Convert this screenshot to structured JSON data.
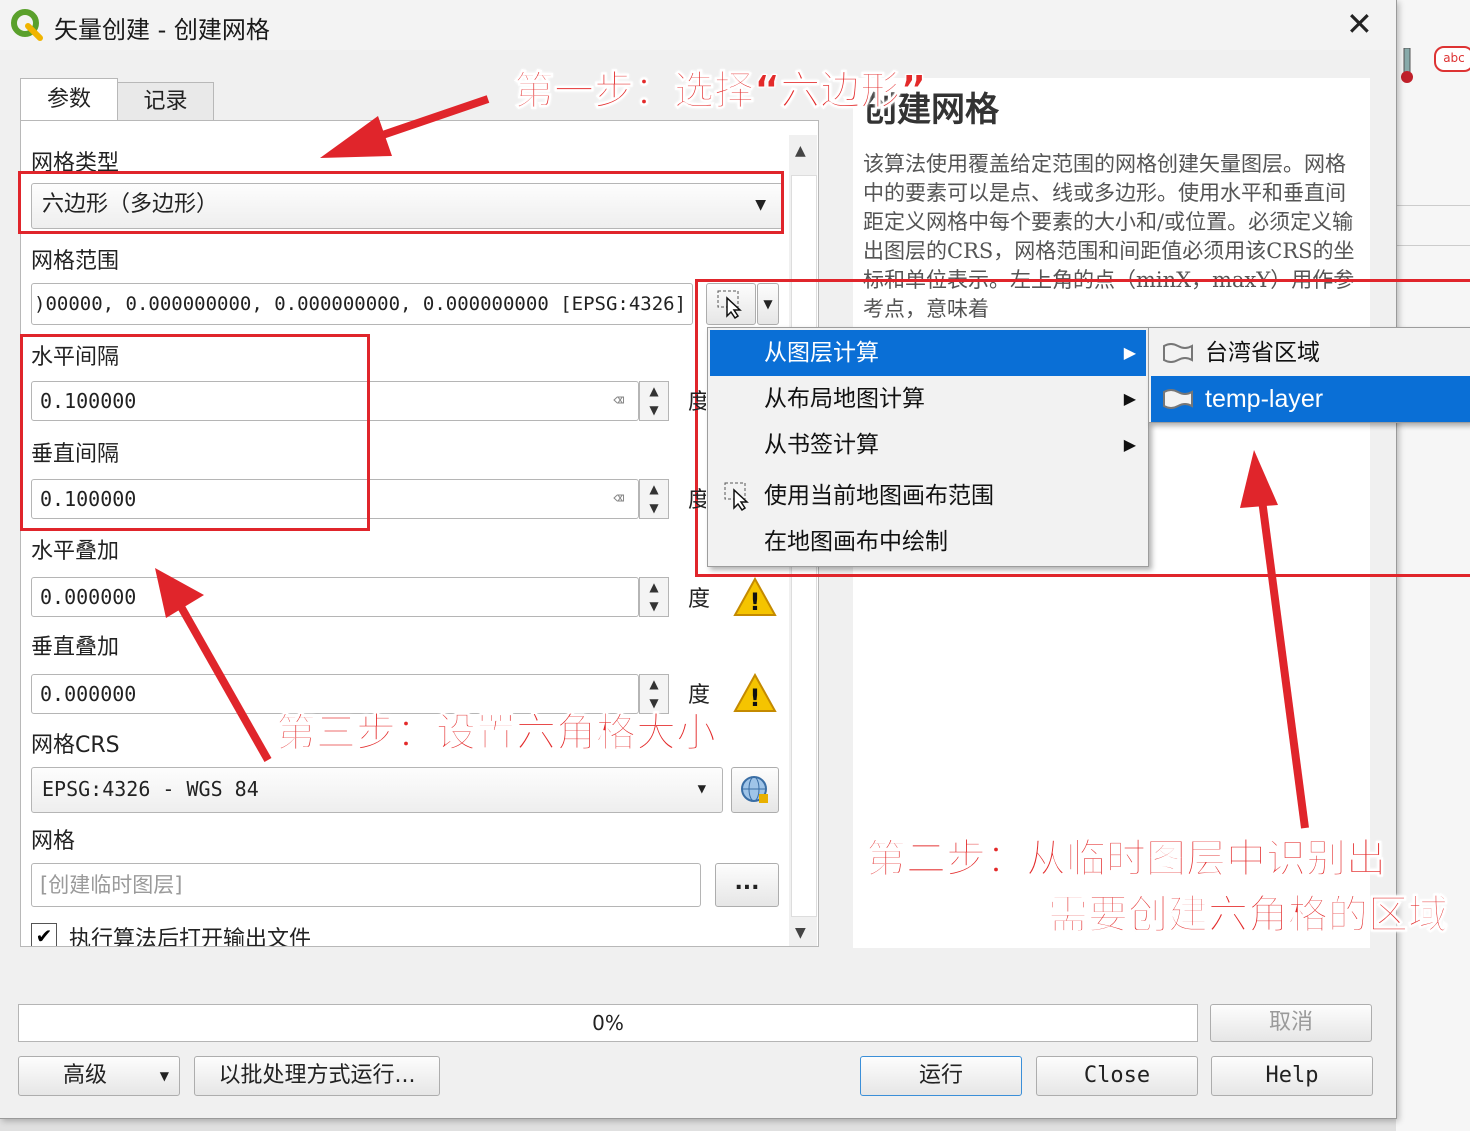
{
  "window": {
    "title": "矢量创建 - 创建网格"
  },
  "tabs": [
    {
      "label": "参数"
    },
    {
      "label": "记录"
    }
  ],
  "params": {
    "grid_type_label": "网格类型",
    "grid_type_value": "六边形（多边形）",
    "grid_extent_label": "网格范围",
    "grid_extent_value": ")00000, 0.000000000, 0.000000000, 0.000000000 [EPSG:4326]",
    "h_spacing_label": "水平间隔",
    "h_spacing_value": "0.100000",
    "h_spacing_unit": "度",
    "v_spacing_label": "垂直间隔",
    "v_spacing_value": "0.100000",
    "v_spacing_unit": "度",
    "h_overlay_label": "水平叠加",
    "h_overlay_value": "0.000000",
    "h_overlay_unit": "度",
    "v_overlay_label": "垂直叠加",
    "v_overlay_value": "0.000000",
    "v_overlay_unit": "度",
    "crs_label": "网格CRS",
    "crs_value": "EPSG:4326 - WGS 84",
    "output_label": "网格",
    "output_placeholder": "[创建临时图层]",
    "output_browse": "...",
    "open_after_label": "执行算法后打开输出文件"
  },
  "help": {
    "title": "创建网格",
    "body": "该算法使用覆盖给定范围的网格创建矢量图层。网格中的要素可以是点、线或多边形。使用水平和垂直间距定义网格中每个要素的大小和/或位置。必须定义输出图层的CRS，网格范围和间距值必须用该CRS的坐标和单位表示。左上角的点（minX，maxY）用作参考点，意味着"
  },
  "extent_menu": {
    "items": [
      {
        "label": "从图层计算",
        "submenu": true,
        "highlighted": true
      },
      {
        "label": "从布局地图计算",
        "submenu": true
      },
      {
        "label": "从书签计算",
        "submenu": true
      },
      {
        "label": "使用当前地图画布范围",
        "icon": "cursor-extent-icon"
      },
      {
        "label": "在地图画布中绘制"
      }
    ]
  },
  "layer_submenu": {
    "items": [
      {
        "label": "台湾省区域",
        "icon": "polygon-layer-icon"
      },
      {
        "label": "temp-layer",
        "icon": "polygon-layer-icon",
        "highlighted": true
      }
    ]
  },
  "annotations": {
    "step1": "第一步：选择“六边形”",
    "step2_line1": "第二步：从临时图层中识别出",
    "step2_line2": "需要创建六角格的区域",
    "step3": "第三步：设置六角格大小"
  },
  "bottom": {
    "progress_text": "0%",
    "progress_value": 0,
    "cancel": "取消",
    "advanced": "高级",
    "batch": "以批处理方式运行...",
    "run": "运行",
    "close": "Close",
    "help": "Help"
  },
  "background_right": {
    "badge": "abc"
  },
  "colors": {
    "annotation_red": "#e0252b",
    "highlight_blue": "#0a6fd6"
  }
}
